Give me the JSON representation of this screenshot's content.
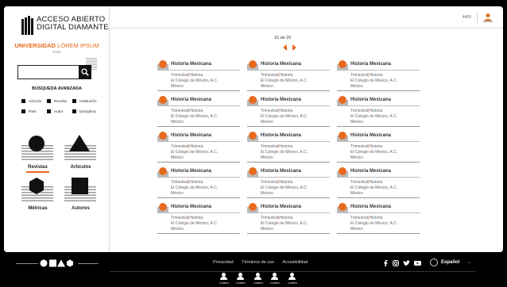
{
  "brand": {
    "line1": "ACCESO ABIERTO",
    "line2": "DIGITAL DIAMANTE",
    "university_bold": "UNIVERSIDAD",
    "university_thin": "LOREM IPSUM",
    "country": "PAÍS",
    "accent_color": "#e86a1f"
  },
  "search": {
    "placeholder": "",
    "icon": "search-icon"
  },
  "advanced_search": {
    "label": "BÚSQUEDA AVANZADA"
  },
  "filters": [
    "Artículo",
    "Revista",
    "Institución",
    "País",
    "Autor",
    "Disciplina"
  ],
  "tiles": [
    {
      "label": "Revistas",
      "icon": "circle-icon",
      "active": true
    },
    {
      "label": "Artículos",
      "icon": "triangle-icon",
      "active": false
    },
    {
      "label": "Métricas",
      "icon": "hexagon-icon",
      "active": false
    },
    {
      "label": "Autores",
      "icon": "square-icon",
      "active": false
    }
  ],
  "topbar": {
    "code": "4405",
    "user_icon": "user-icon"
  },
  "pager": {
    "text": "15 de 20"
  },
  "cards": [
    {
      "title": "Historia Mexicana",
      "period": "Trimestral",
      "discipline": "Historia",
      "publisher": "El Colegio de México, A.C.",
      "country": "México"
    },
    {
      "title": "Historia Mexicana",
      "period": "Trimestral",
      "discipline": "Historia",
      "publisher": "El Colegio de México, A.C.",
      "country": "México"
    },
    {
      "title": "Historia Mexicana",
      "period": "Trimestral",
      "discipline": "Historia",
      "publisher": "El Colegio de México, A.C.",
      "country": "México"
    },
    {
      "title": "Historia Mexicana",
      "period": "Trimestral",
      "discipline": "Historia",
      "publisher": "El Colegio de México, A.C.",
      "country": "México"
    },
    {
      "title": "Historia Mexicana",
      "period": "Trimestral",
      "discipline": "Historia",
      "publisher": "El Colegio de México, A.C.",
      "country": "México"
    },
    {
      "title": "Historia Mexicana",
      "period": "Trimestral",
      "discipline": "Historia",
      "publisher": "El Colegio de México, A.C.",
      "country": "México"
    },
    {
      "title": "Historia Mexicana",
      "period": "Trimestral",
      "discipline": "Historia",
      "publisher": "El Colegio de México, A.C.",
      "country": "México"
    },
    {
      "title": "Historia Mexicana",
      "period": "Trimestral",
      "discipline": "Historia",
      "publisher": "El Colegio de México, A.C.",
      "country": "México"
    },
    {
      "title": "Historia Mexicana",
      "period": "Trimestral",
      "discipline": "Historia",
      "publisher": "El Colegio de México, A.C.",
      "country": "México"
    },
    {
      "title": "Historia Mexicana",
      "period": "Trimestral",
      "discipline": "Historia",
      "publisher": "El Colegio de México, A.C.",
      "country": "México"
    },
    {
      "title": "Historia Mexicana",
      "period": "Trimestral",
      "discipline": "Historia",
      "publisher": "El Colegio de México, A.C.",
      "country": "México"
    },
    {
      "title": "Historia Mexicana",
      "period": "Trimestral",
      "discipline": "Historia",
      "publisher": "El Colegio de México, A.C.",
      "country": "México"
    },
    {
      "title": "Historia Mexicana",
      "period": "Trimestral",
      "discipline": "Historia",
      "publisher": "El Colegio de México, A.C.",
      "country": "México"
    },
    {
      "title": "Historia Mexicana",
      "period": "Trimestral",
      "discipline": "Historia",
      "publisher": "El Colegio de México, A.C.",
      "country": "México"
    },
    {
      "title": "Historia Mexicana",
      "period": "Trimestral",
      "discipline": "Historia",
      "publisher": "El Colegio de México, A.C.",
      "country": "México"
    }
  ],
  "footer": {
    "links": [
      "Privacidad",
      "Términos de uso",
      "Accesibilidad"
    ],
    "social": [
      "facebook-icon",
      "instagram-icon",
      "twitter-icon",
      "youtube-icon"
    ],
    "language": "Español",
    "people": [
      "Lorem",
      "Lorem",
      "Lorem",
      "Lorem",
      "Lorem"
    ]
  }
}
